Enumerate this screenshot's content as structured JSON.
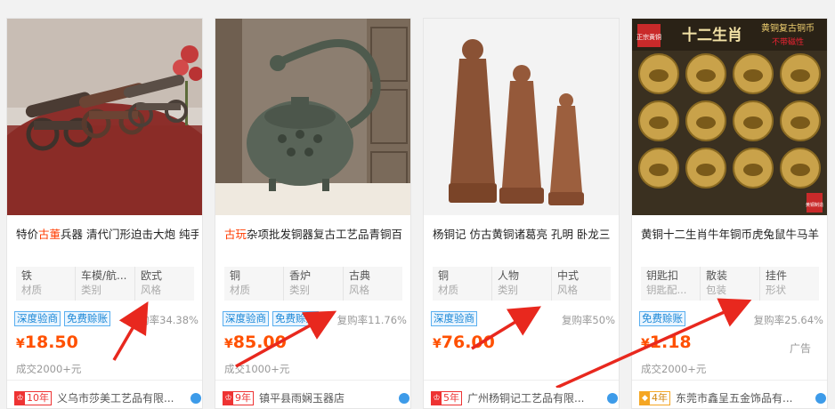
{
  "products": [
    {
      "title_hl_prefix": "特价",
      "title_hl": "古董",
      "title_rest": "兵器 清代门形迫击大炮 纯手",
      "attrs": [
        {
          "value": "铁",
          "key": "材质"
        },
        {
          "value": "车模/航...",
          "key": "类别"
        },
        {
          "value": "欧式",
          "key": "风格"
        }
      ],
      "tags": [
        "深度验商",
        "免费赊账"
      ],
      "rebuy": "复购率34.38%",
      "price_symbol": "¥",
      "price": "18.50",
      "sales": "成交2000+元",
      "badge_years": "10年",
      "shop": "义乌市莎美工艺品有限..."
    },
    {
      "title_hl": "古玩",
      "title_rest": "杂项批发铜器复古工艺品青铜百",
      "attrs": [
        {
          "value": "铜",
          "key": "材质"
        },
        {
          "value": "香炉",
          "key": "类别"
        },
        {
          "value": "古典",
          "key": "风格"
        }
      ],
      "tags": [
        "深度验商",
        "免费赊账"
      ],
      "rebuy": "复购率11.76%",
      "price_symbol": "¥",
      "price": "85.00",
      "sales": "成交1000+元",
      "badge_years": "9年",
      "shop": "镇平县雨娴玉器店"
    },
    {
      "title": "杨铜记 仿古黄铜诸葛亮 孔明 卧龙三",
      "attrs": [
        {
          "value": "铜",
          "key": "材质"
        },
        {
          "value": "人物",
          "key": "类别"
        },
        {
          "value": "中式",
          "key": "风格"
        }
      ],
      "tags": [
        "深度验商"
      ],
      "rebuy": "复购率50%",
      "price_symbol": "¥",
      "price": "76.00",
      "badge_years": "5年",
      "shop": "广州杨铜记工艺品有限..."
    },
    {
      "title": "黄铜十二生肖牛年铜币虎兔鼠牛马羊",
      "attrs": [
        {
          "value": "钥匙扣",
          "key": "钥匙配..."
        },
        {
          "value": "散装",
          "key": "包装"
        },
        {
          "value": "挂件",
          "key": "形状"
        }
      ],
      "tags": [
        "免费赊账"
      ],
      "rebuy": "复购率25.64%",
      "price_symbol": "¥",
      "price": "1.18",
      "ad": "广告",
      "sales": "成交2000+元",
      "badge_years": "4年",
      "shop": "东莞市鑫呈五金饰品有...",
      "image_text": {
        "title": "十二生肖",
        "corner": "黄铜复古铜币",
        "sub": "不带磁性",
        "seal": "正宗黄铜",
        "stamp": "黄铜制造"
      }
    }
  ],
  "colors": {
    "price": "#ff5000",
    "highlight": "#ff3c00",
    "tag_border": "#5aaff0",
    "arrow": "#e8281e"
  }
}
